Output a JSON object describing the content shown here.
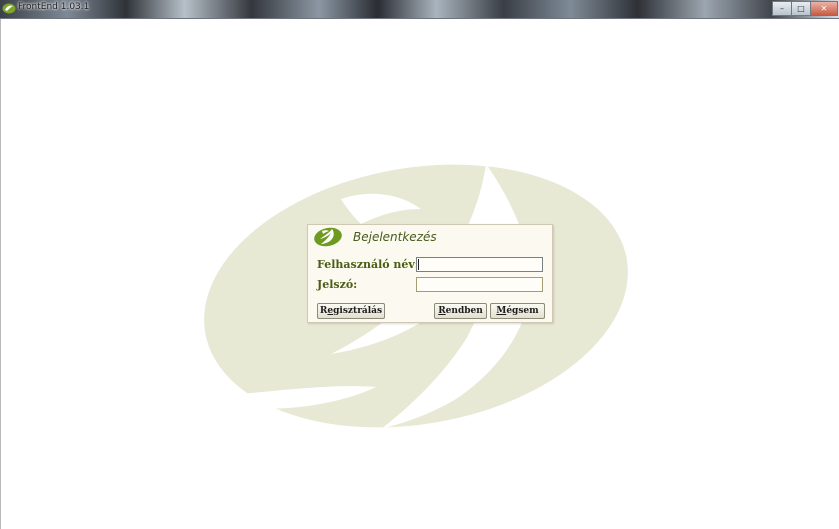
{
  "window": {
    "title": "FrontEnd 1.03.1",
    "controls": {
      "minimize": "–",
      "maximize": "□",
      "close": "✕"
    }
  },
  "colors": {
    "logo_fill": "#e9ebd8",
    "dialog_bg": "#fbf9f0",
    "label_green": "#4a5d14"
  },
  "login": {
    "title": "Bejelentkezés",
    "username_label": "Felhasználó név:",
    "password_label": "Jelszó:",
    "username_value": "",
    "password_value": "",
    "buttons": {
      "register_mnemonic": "e",
      "register_prefix": "R",
      "register_suffix": "gisztrálás",
      "ok_mnemonic": "R",
      "ok_suffix": "endben",
      "cancel_mnemonic": "M",
      "cancel_suffix": "égsem"
    }
  }
}
